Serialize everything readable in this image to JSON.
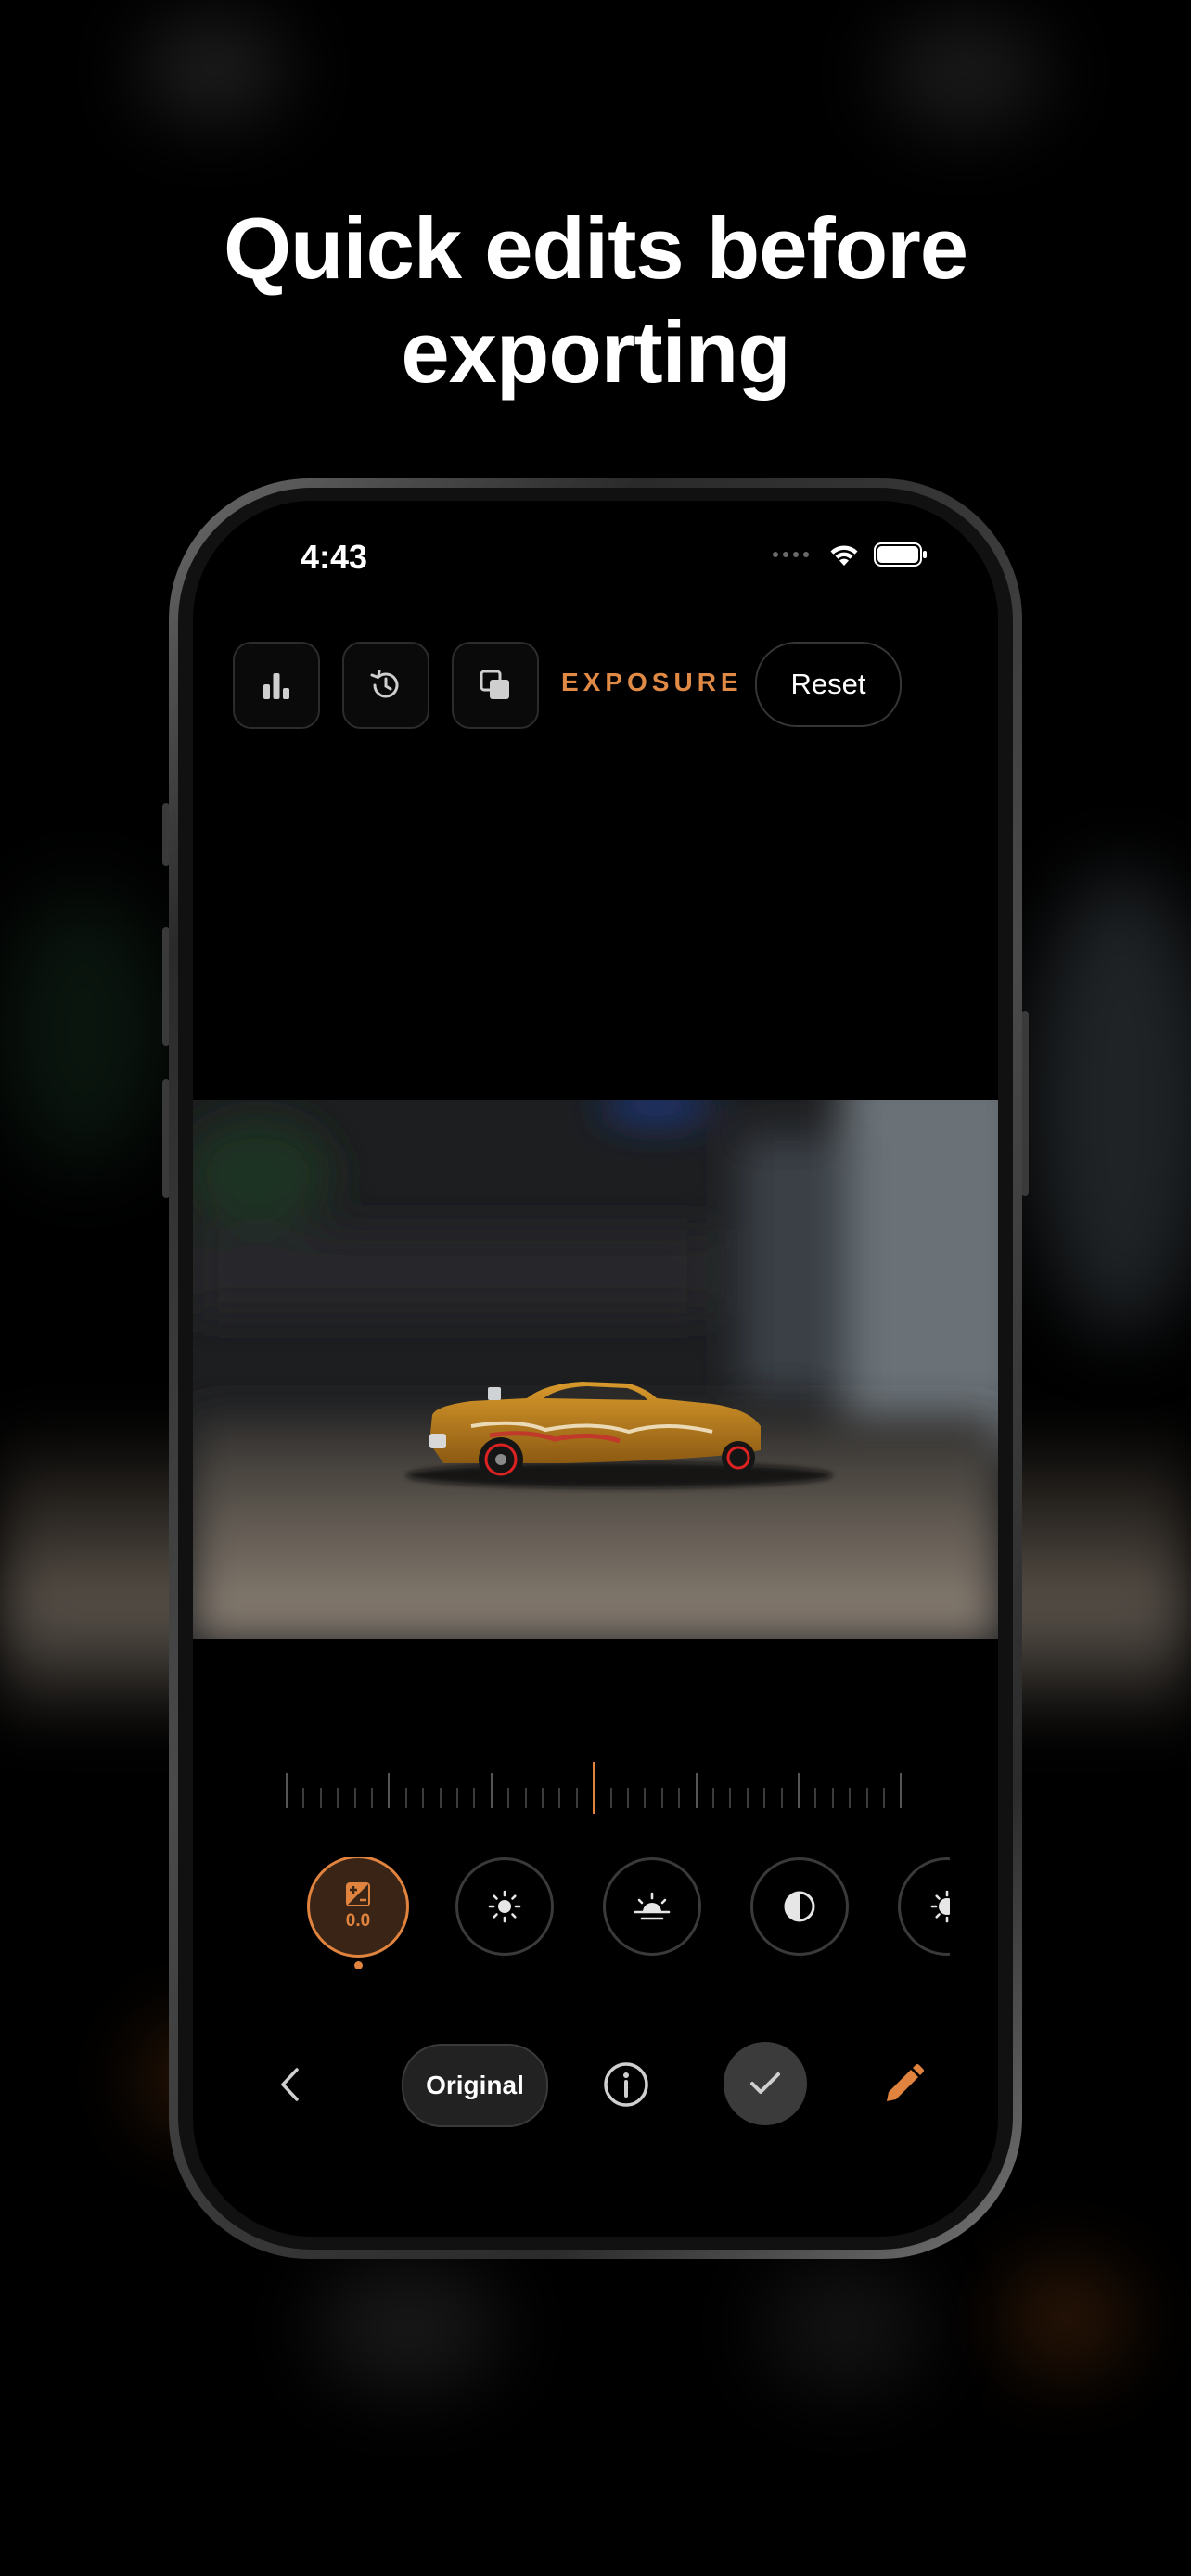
{
  "headline": {
    "line1": "Quick edits before",
    "line2": "exporting"
  },
  "status_bar": {
    "time": "4:43",
    "icons": [
      "cellular-dots-icon",
      "wifi-icon",
      "battery-icon"
    ]
  },
  "toolbar": {
    "buttons": [
      "histogram-icon",
      "history-icon",
      "copy-icon"
    ],
    "mode_label": "EXPOSURE",
    "reset_label": "Reset"
  },
  "photo": {
    "subject": "orange toy car with flame decals"
  },
  "adjustment": {
    "value_label": "0.0",
    "active_tool": "exposure"
  },
  "tools": [
    "exposure-icon",
    "brightness-icon",
    "highlights-icon",
    "contrast-icon",
    "shadows-icon"
  ],
  "bottom_bar": {
    "back_icon": "chevron-left-icon",
    "original_label": "Original",
    "info_icon": "info-icon",
    "done_icon": "checkmark-icon",
    "edit_icon": "pencil-icon"
  },
  "colors": {
    "accent": "#e0833e",
    "background": "#000000",
    "control_border": "#3a3a3a"
  }
}
